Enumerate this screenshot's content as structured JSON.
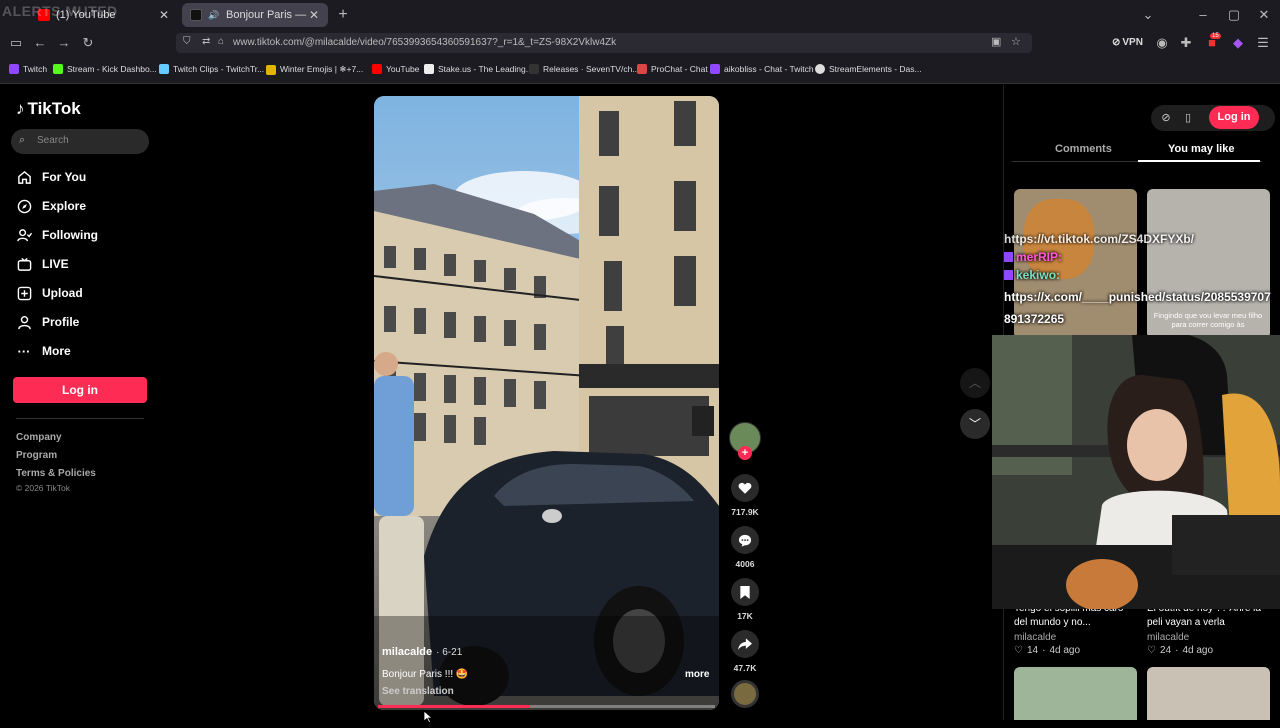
{
  "browser": {
    "overlay_text": "ALERTS MUTED",
    "tabs": [
      {
        "title": "(1) YouTube",
        "active": false
      },
      {
        "title": "Bonjour Paris — réaction d",
        "active": true
      }
    ],
    "new_tab": "+",
    "url": "www.tiktok.com/@milacalde/video/7653993654360591637?_r=1&_t=ZS-98X2Vklw4Zk",
    "vpn_label": "VPN",
    "notif_badge": "15",
    "bookmarks": [
      {
        "label": "Twitch",
        "color": "#9146ff"
      },
      {
        "label": "Stream - Kick Dashbo...",
        "color": "#53fc18"
      },
      {
        "label": "Twitch Clips - TwitchTr...",
        "color": "#6cf"
      },
      {
        "label": "Winter Emojis | ❄+7...",
        "color": "#e6b400"
      },
      {
        "label": "YouTube",
        "color": "#ff0000"
      },
      {
        "label": "Stake.us - The Leading...",
        "color": "#eee"
      },
      {
        "label": "Releases · SevenTV/ch...",
        "color": "#333"
      },
      {
        "label": "ProChat - Chat",
        "color": "#e04545"
      },
      {
        "label": "aikobliss - Chat - Twitch",
        "color": "#9146ff"
      },
      {
        "label": "StreamElements - Das...",
        "color": "#ddd"
      }
    ]
  },
  "tiktok": {
    "logo": "TikTok",
    "search_placeholder": "Search",
    "nav": [
      "For You",
      "Explore",
      "Following",
      "LIVE",
      "Upload",
      "Profile",
      "More"
    ],
    "login": "Log in",
    "footer": [
      "Company",
      "Program",
      "Terms & Policies",
      "© 2026 TikTok"
    ],
    "video": {
      "author": "milacalde",
      "date": "· 6-21",
      "caption": "Bonjour Paris !!! 🤩",
      "see_translation": "See translation",
      "more": "more",
      "progress": 0.45
    },
    "actions": {
      "likes": "717.9K",
      "comments": "4006",
      "saves": "17K",
      "shares": "47.7K"
    },
    "right_tabs": [
      "Comments",
      "You may like"
    ],
    "cards": [
      {
        "title": "Tengo el sopilli más caro del mundo y no...",
        "author": "milacalde",
        "likes": "14",
        "age": "4d ago"
      },
      {
        "title": "El outfit de hoy ?? Ahre la peli vayan a verla",
        "author": "milacalde",
        "likes": "24",
        "age": "4d ago"
      }
    ],
    "card2_thumb_text": "Fingindo que vou levar meu filho para correr comigo às"
  },
  "overlay": {
    "chat_lines": [
      "https://vt.tiktok.com/ZS4DXFYXb/",
      "merRIP:",
      "kekiwo:"
    ],
    "chat_link": "https://x.com/____punished/status/2085539707891372265"
  },
  "colors": {
    "accent": "#fe2c55",
    "bg": "#000000",
    "chrome": "#1c1b22"
  }
}
